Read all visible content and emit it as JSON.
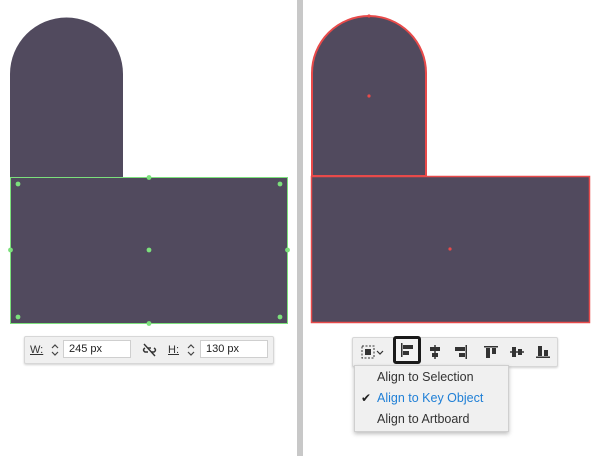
{
  "colors": {
    "shape_fill": "#514a5e",
    "selection_green": "#7ce07c",
    "key_object_red": "#e84a4a",
    "menu_active": "#1f7fd6"
  },
  "transform_toolbar": {
    "width_label": "W:",
    "width_value": "245 px",
    "height_label": "H:",
    "height_value": "130 px",
    "icons": [
      "stepper-icon",
      "link-broken-icon",
      "stepper-icon"
    ]
  },
  "align_toolbar": {
    "icons": [
      "align-to-dropdown-icon",
      "align-left-icon",
      "align-horizontal-center-icon",
      "align-right-icon",
      "align-top-icon",
      "align-vertical-center-icon",
      "align-bottom-icon"
    ]
  },
  "align_menu": {
    "items": [
      {
        "label": "Align to Selection",
        "checked": false
      },
      {
        "label": "Align to Key Object",
        "checked": true
      },
      {
        "label": "Align to Artboard",
        "checked": false
      }
    ]
  }
}
